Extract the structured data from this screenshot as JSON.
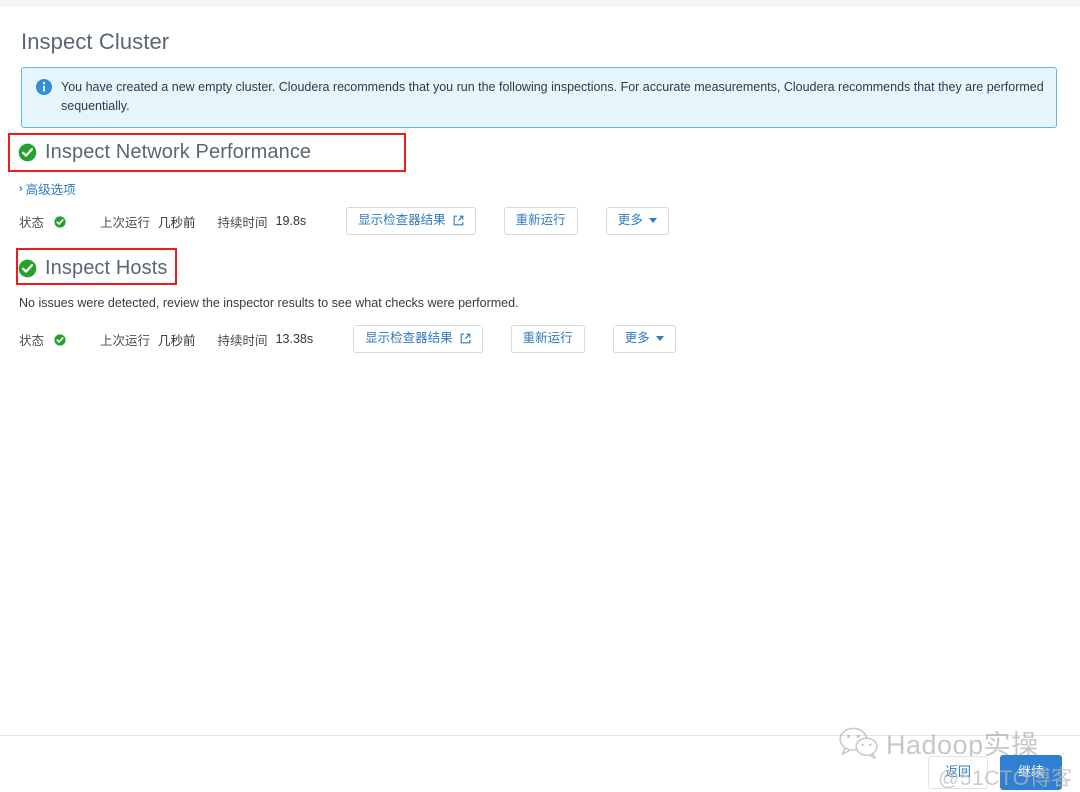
{
  "page": {
    "title": "Inspect Cluster"
  },
  "banner": {
    "icon": "info-circle-icon",
    "text": "You have created a new empty cluster. Cloudera recommends that you run the following inspections. For accurate measurements, Cloudera recommends that they are performed sequentially.",
    "background_color": "#e6f4fc",
    "border_color": "#62b5e5",
    "icon_color": "#2f8fd8"
  },
  "sections": [
    {
      "id": "inspect-network-performance",
      "status_icon": "check-circle-icon",
      "heading": "Inspect Network Performance",
      "advanced_link": "高级选项",
      "advanced_chevron": "›",
      "helper_text": "",
      "status": {
        "status_label": "状态",
        "status_icon": "check-circle-icon",
        "last_run_label": "上次运行",
        "last_run_value": "几秒前",
        "duration_label": "持续时间",
        "duration_value": "19.8s"
      },
      "buttons": {
        "show_results": "显示检查器结果",
        "show_results_icon": "external-link-icon",
        "rerun": "重新运行",
        "more": "更多",
        "more_icon": "chevron-down-icon"
      }
    },
    {
      "id": "inspect-hosts",
      "status_icon": "check-circle-icon",
      "heading": "Inspect Hosts",
      "advanced_link": "",
      "advanced_chevron": "",
      "helper_text": "No issues were detected, review the inspector results to see what checks were performed.",
      "status": {
        "status_label": "状态",
        "status_icon": "check-circle-icon",
        "last_run_label": "上次运行",
        "last_run_value": "几秒前",
        "duration_label": "持续时间",
        "duration_value": "13.38s"
      },
      "buttons": {
        "show_results": "显示检查器结果",
        "show_results_icon": "external-link-icon",
        "rerun": "重新运行",
        "more": "更多",
        "more_icon": "chevron-down-icon"
      }
    }
  ],
  "footer": {
    "back_label": "返回",
    "continue_label": "继续",
    "continue_color": "#2f80d2"
  },
  "watermarks": {
    "brand_text": "Hadoop实操",
    "brand_icon": "wechat-icon",
    "site_text": "@51CTO博客"
  },
  "annotations": {
    "color": "#ef1c1c",
    "boxes": [
      {
        "target": "Inspect Network Performance"
      },
      {
        "target": "Inspect Hosts"
      }
    ]
  },
  "theme": {
    "status_green": "#27a02c",
    "link_blue": "#2f7bbf",
    "heading_gray": "#5a6672"
  }
}
